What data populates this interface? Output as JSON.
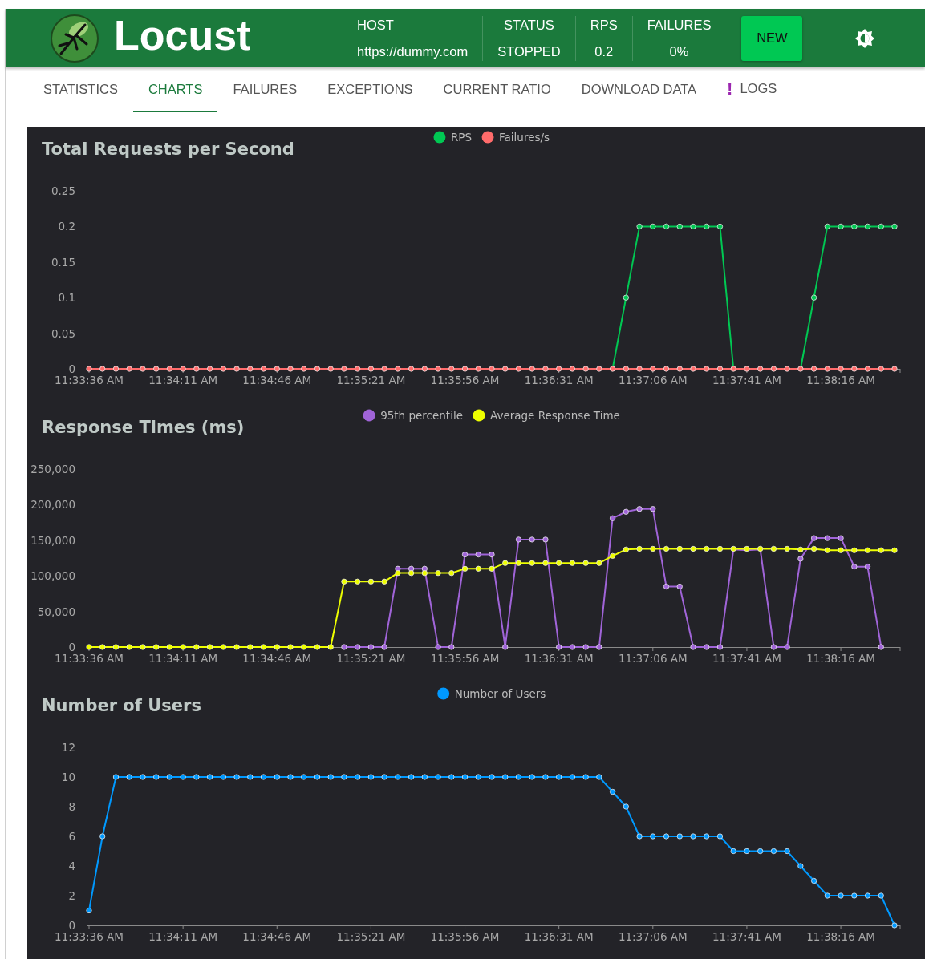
{
  "header": {
    "title": "Locust",
    "stats": [
      {
        "label": "HOST",
        "value": "https://dummy.com"
      },
      {
        "label": "STATUS",
        "value": "STOPPED"
      },
      {
        "label": "RPS",
        "value": "0.2"
      },
      {
        "label": "FAILURES",
        "value": "0%"
      }
    ],
    "new_button": "NEW"
  },
  "tabs": [
    {
      "label": "STATISTICS",
      "selected": false
    },
    {
      "label": "CHARTS",
      "selected": true
    },
    {
      "label": "FAILURES",
      "selected": false
    },
    {
      "label": "EXCEPTIONS",
      "selected": false
    },
    {
      "label": "CURRENT RATIO",
      "selected": false
    },
    {
      "label": "DOWNLOAD DATA",
      "selected": false
    },
    {
      "label": "LOGS",
      "selected": false,
      "badge": "!"
    }
  ],
  "charts": [
    {
      "chart_data": {
        "type": "line",
        "title": "Total Requests per Second",
        "legend": "top",
        "ylim": [
          0,
          0.25
        ],
        "categories": [
          "11:33:36 AM",
          null,
          null,
          null,
          null,
          null,
          null,
          "11:34:11 AM",
          null,
          null,
          null,
          null,
          null,
          null,
          "11:34:46 AM",
          null,
          null,
          null,
          null,
          null,
          null,
          "11:35:21 AM",
          null,
          null,
          null,
          null,
          null,
          null,
          "11:35:56 AM",
          null,
          null,
          null,
          null,
          null,
          null,
          "11:36:31 AM",
          null,
          null,
          null,
          null,
          null,
          null,
          "11:37:06 AM",
          null,
          null,
          null,
          null,
          null,
          null,
          "11:37:41 AM",
          null,
          null,
          null,
          null,
          null,
          null,
          "11:38:16 AM",
          null,
          null,
          null,
          null
        ],
        "yticks": [
          {
            "value": 0,
            "label": "0"
          },
          {
            "value": 0.05,
            "label": "0.05"
          },
          {
            "value": 0.1,
            "label": "0.1"
          },
          {
            "value": 0.15,
            "label": "0.15"
          },
          {
            "value": 0.2,
            "label": "0.2"
          },
          {
            "value": 0.25,
            "label": "0.25"
          }
        ],
        "series": [
          {
            "name": "RPS",
            "color": "#00c853",
            "marker": "circle",
            "values": [
              null,
              null,
              null,
              null,
              null,
              null,
              null,
              null,
              null,
              null,
              null,
              null,
              null,
              null,
              null,
              null,
              null,
              null,
              null,
              null,
              null,
              null,
              null,
              null,
              null,
              null,
              null,
              null,
              null,
              null,
              null,
              null,
              null,
              null,
              null,
              null,
              null,
              null,
              null,
              0,
              0.1,
              0.2,
              0.2,
              0.2,
              0.2,
              0.2,
              0.2,
              0.2,
              0,
              null,
              null,
              null,
              null,
              0,
              0.1,
              0.2,
              0.2,
              0.2,
              0.2,
              0.2,
              0.2
            ]
          },
          {
            "name": "Failures/s",
            "color": "#ff6b6b",
            "marker": "circle",
            "values": [
              0,
              0,
              0,
              0,
              0,
              0,
              0,
              0,
              0,
              0,
              0,
              0,
              0,
              0,
              0,
              0,
              0,
              0,
              0,
              0,
              0,
              0,
              0,
              0,
              0,
              0,
              0,
              0,
              0,
              0,
              0,
              0,
              0,
              0,
              0,
              0,
              0,
              0,
              0,
              0,
              0,
              0,
              0,
              0,
              0,
              0,
              0,
              0,
              0,
              0,
              0,
              0,
              0,
              0,
              0,
              0,
              0,
              0,
              0,
              0,
              0
            ]
          }
        ]
      }
    },
    {
      "chart_data": {
        "type": "line",
        "title": "Response Times (ms)",
        "legend": "top",
        "ylim": [
          0,
          250000
        ],
        "categories": [
          "11:33:36 AM",
          null,
          null,
          null,
          null,
          null,
          null,
          "11:34:11 AM",
          null,
          null,
          null,
          null,
          null,
          null,
          "11:34:46 AM",
          null,
          null,
          null,
          null,
          null,
          null,
          "11:35:21 AM",
          null,
          null,
          null,
          null,
          null,
          null,
          "11:35:56 AM",
          null,
          null,
          null,
          null,
          null,
          null,
          "11:36:31 AM",
          null,
          null,
          null,
          null,
          null,
          null,
          "11:37:06 AM",
          null,
          null,
          null,
          null,
          null,
          null,
          "11:37:41 AM",
          null,
          null,
          null,
          null,
          null,
          null,
          "11:38:16 AM",
          null,
          null,
          null,
          null
        ],
        "yticks": [
          {
            "value": 0,
            "label": "0"
          },
          {
            "value": 50000,
            "label": "50,000"
          },
          {
            "value": 100000,
            "label": "100,000"
          },
          {
            "value": 150000,
            "label": "150,000"
          },
          {
            "value": 200000,
            "label": "200,000"
          },
          {
            "value": 250000,
            "label": "250,000"
          }
        ],
        "series": [
          {
            "name": "95th percentile",
            "color": "#a064d8",
            "marker": "circle",
            "values": [
              null,
              null,
              null,
              null,
              null,
              null,
              null,
              null,
              null,
              null,
              null,
              null,
              null,
              null,
              null,
              null,
              null,
              null,
              null,
              0,
              0,
              0,
              0,
              110000,
              110000,
              110000,
              0,
              0,
              130000,
              130000,
              130000,
              0,
              151000,
              151000,
              151000,
              0,
              0,
              0,
              0,
              181000,
              190000,
              194000,
              194000,
              85000,
              85000,
              0,
              0,
              0,
              137000,
              136000,
              137000,
              0,
              0,
              124000,
              153000,
              153000,
              153000,
              113000,
              113000,
              0,
              null
            ]
          },
          {
            "name": "Average Response Time",
            "color": "#eeff00",
            "marker": "circle",
            "values": [
              0,
              0,
              0,
              0,
              0,
              0,
              0,
              0,
              0,
              0,
              0,
              0,
              0,
              0,
              0,
              0,
              0,
              0,
              0,
              92000,
              92000,
              92000,
              92000,
              104000,
              104000,
              104000,
              104000,
              104000,
              110000,
              110000,
              110000,
              118000,
              118000,
              118000,
              118000,
              118000,
              118000,
              118000,
              118000,
              128000,
              137000,
              138000,
              138000,
              138000,
              138000,
              138000,
              138000,
              138000,
              138000,
              138000,
              138000,
              138000,
              138000,
              137000,
              138000,
              136000,
              136000,
              136000,
              136000,
              136000,
              136000
            ]
          }
        ]
      }
    },
    {
      "chart_data": {
        "type": "line",
        "title": "Number of Users",
        "legend": "top",
        "ylim": [
          0,
          12
        ],
        "categories": [
          "11:33:36 AM",
          null,
          null,
          null,
          null,
          null,
          null,
          "11:34:11 AM",
          null,
          null,
          null,
          null,
          null,
          null,
          "11:34:46 AM",
          null,
          null,
          null,
          null,
          null,
          null,
          "11:35:21 AM",
          null,
          null,
          null,
          null,
          null,
          null,
          "11:35:56 AM",
          null,
          null,
          null,
          null,
          null,
          null,
          "11:36:31 AM",
          null,
          null,
          null,
          null,
          null,
          null,
          "11:37:06 AM",
          null,
          null,
          null,
          null,
          null,
          null,
          "11:37:41 AM",
          null,
          null,
          null,
          null,
          null,
          null,
          "11:38:16 AM",
          null,
          null,
          null,
          null
        ],
        "yticks": [
          0,
          2,
          4,
          6,
          8,
          10,
          12
        ],
        "series": [
          {
            "name": "Number of Users",
            "color": "#0099ff",
            "marker": "circle",
            "values": [
              1,
              6,
              10,
              10,
              10,
              10,
              10,
              10,
              10,
              10,
              10,
              10,
              10,
              10,
              10,
              10,
              10,
              10,
              10,
              10,
              10,
              10,
              10,
              10,
              10,
              10,
              10,
              10,
              10,
              10,
              10,
              10,
              10,
              10,
              10,
              10,
              10,
              10,
              10,
              9,
              8,
              6,
              6,
              6,
              6,
              6,
              6,
              6,
              5,
              5,
              5,
              5,
              5,
              4,
              3,
              2,
              2,
              2,
              2,
              2,
              0
            ]
          }
        ]
      }
    }
  ]
}
